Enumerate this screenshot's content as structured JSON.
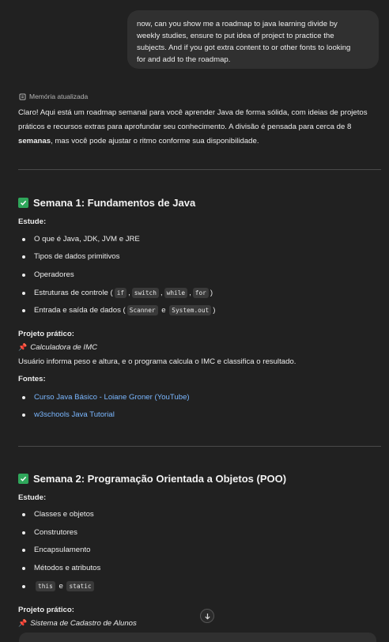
{
  "user_message": {
    "lines": [
      "now, can you show me a roadmap to java learning divide by",
      "weekly studies, ensure to put idea of project to practice the",
      "subjects. And if you got extra content to or other fonts to looking",
      "for and add to the roadmap."
    ]
  },
  "memory_status": "Memória atualizada",
  "intro": {
    "line1": "Claro! Aqui está um roadmap semanal para você aprender Java de forma sólida, com ideias de projetos",
    "line2": "práticos e recursos extras para aprofundar seu conhecimento. A divisão é pensada para cerca de 8",
    "line3_bold": "semanas",
    "line3_rest": ", mas você pode ajustar o ritmo conforme sua disponibilidade."
  },
  "week1": {
    "title": "Semana 1: Fundamentos de Java",
    "study_label": "Estude:",
    "topics": [
      "O que é Java, JDK, JVM e JRE",
      "Tipos de dados primitivos",
      "Operadores"
    ],
    "control": {
      "prefix": "Estruturas de controle (",
      "codes": [
        "if",
        "switch",
        "while",
        "for"
      ],
      "suffix": ")"
    },
    "io": {
      "prefix": "Entrada e saída de dados (",
      "code1": "Scanner",
      "mid": " e ",
      "code2": "System.out",
      "suffix": ")"
    },
    "project_label": "Projeto prático:",
    "project_name": "Calculadora de IMC",
    "project_desc": "Usuário informa peso e altura, e o programa calcula o IMC e classifica o resultado.",
    "sources_label": "Fontes:",
    "sources": [
      "Curso Java Básico - Loiane Groner (YouTube)",
      "w3schools Java Tutorial"
    ]
  },
  "week2": {
    "title": "Semana 2: Programação Orientada a Objetos (POO)",
    "study_label": "Estude:",
    "topics": [
      "Classes e objetos",
      "Construtores",
      "Encapsulamento",
      "Métodos e atributos"
    ],
    "this_static": {
      "code1": "this",
      "mid": " e ",
      "code2": "static"
    },
    "project_label": "Projeto prático:",
    "project_name": "Sistema de Cadastro de Alunos"
  },
  "colors": {
    "background": "#212121",
    "bubble": "#303030",
    "check": "#2fa75b",
    "link": "#7ab7ff",
    "pin": "#e0453b"
  },
  "icons": [
    "memory-icon",
    "check-icon",
    "pin-icon",
    "arrow-down-icon"
  ]
}
